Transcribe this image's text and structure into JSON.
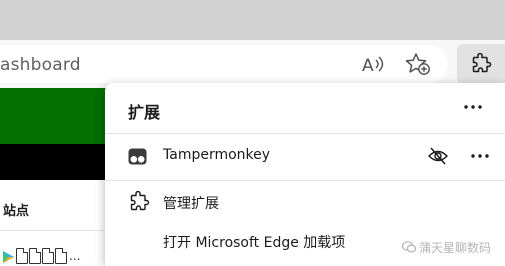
{
  "browser": {
    "address_text": "ashboard",
    "read_aloud_icon": "read-aloud-icon",
    "favorites_icon": "add-favorite-icon",
    "extensions_icon": "puzzle-icon"
  },
  "page": {
    "site_label": "站点",
    "icon_row_trailing": "...",
    "colors": {
      "green": "#047000",
      "black": "#000000"
    }
  },
  "flyout": {
    "title": "扩展",
    "more_icon": "more-horizontal-icon",
    "extensions": [
      {
        "name": "Tampermonkey",
        "icon": "tampermonkey-icon",
        "hide_icon": "eye-hidden-icon",
        "more_icon": "more-horizontal-icon"
      }
    ],
    "manage_label": "管理扩展",
    "manage_icon": "puzzle-icon",
    "open_addons_label": "打开 Microsoft Edge 加载项"
  },
  "watermark": {
    "text": "蒲天星聊数码",
    "logo": "wechat-watermark-logo"
  }
}
